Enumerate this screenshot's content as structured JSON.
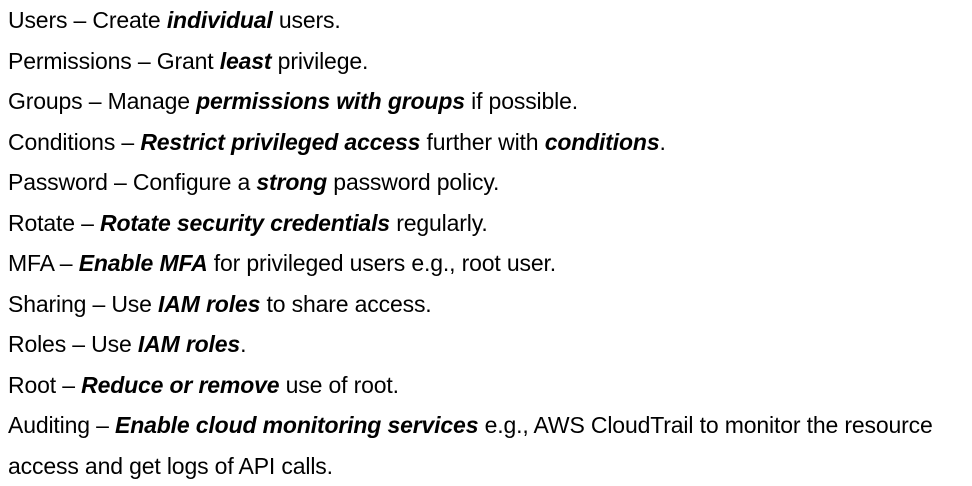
{
  "lines": [
    [
      {
        "text": "Users – Create ",
        "style": "normal"
      },
      {
        "text": "individual",
        "style": "bold-italic"
      },
      {
        "text": " users.",
        "style": "normal"
      }
    ],
    [
      {
        "text": "Permissions – Grant ",
        "style": "normal"
      },
      {
        "text": "least",
        "style": "bold-italic"
      },
      {
        "text": " privilege.",
        "style": "normal"
      }
    ],
    [
      {
        "text": "Groups – Manage ",
        "style": "normal"
      },
      {
        "text": "permissions with groups",
        "style": "bold-italic"
      },
      {
        "text": " if possible.",
        "style": "normal"
      }
    ],
    [
      {
        "text": "Conditions – ",
        "style": "normal"
      },
      {
        "text": "Restrict privileged access",
        "style": "bold-italic"
      },
      {
        "text": " further with ",
        "style": "normal"
      },
      {
        "text": "conditions",
        "style": "bold-italic"
      },
      {
        "text": ".",
        "style": "normal"
      }
    ],
    [
      {
        "text": "Password – Configure a ",
        "style": "normal"
      },
      {
        "text": "strong",
        "style": "bold-italic"
      },
      {
        "text": " password policy.",
        "style": "normal"
      }
    ],
    [
      {
        "text": "Rotate – ",
        "style": "normal"
      },
      {
        "text": "Rotate security credentials",
        "style": "bold-italic"
      },
      {
        "text": " regularly.",
        "style": "normal"
      }
    ],
    [
      {
        "text": "MFA – ",
        "style": "normal"
      },
      {
        "text": "Enable MFA",
        "style": "bold-italic"
      },
      {
        "text": " for privileged users e.g., root user.",
        "style": "normal"
      }
    ],
    [
      {
        "text": "Sharing – Use ",
        "style": "normal"
      },
      {
        "text": "IAM roles",
        "style": "bold-italic"
      },
      {
        "text": " to share access.",
        "style": "normal"
      }
    ],
    [
      {
        "text": "Roles – Use ",
        "style": "normal"
      },
      {
        "text": "IAM roles",
        "style": "bold-italic"
      },
      {
        "text": ".",
        "style": "normal"
      }
    ],
    [
      {
        "text": "Root – ",
        "style": "normal"
      },
      {
        "text": "Reduce or remove",
        "style": "bold-italic"
      },
      {
        "text": " use of root.",
        "style": "normal"
      }
    ],
    [
      {
        "text": "Auditing – ",
        "style": "normal"
      },
      {
        "text": "Enable cloud monitoring services",
        "style": "bold-italic"
      },
      {
        "text": " e.g., AWS CloudTrail to monitor the resource access and get logs of API calls.",
        "style": "normal"
      }
    ]
  ]
}
